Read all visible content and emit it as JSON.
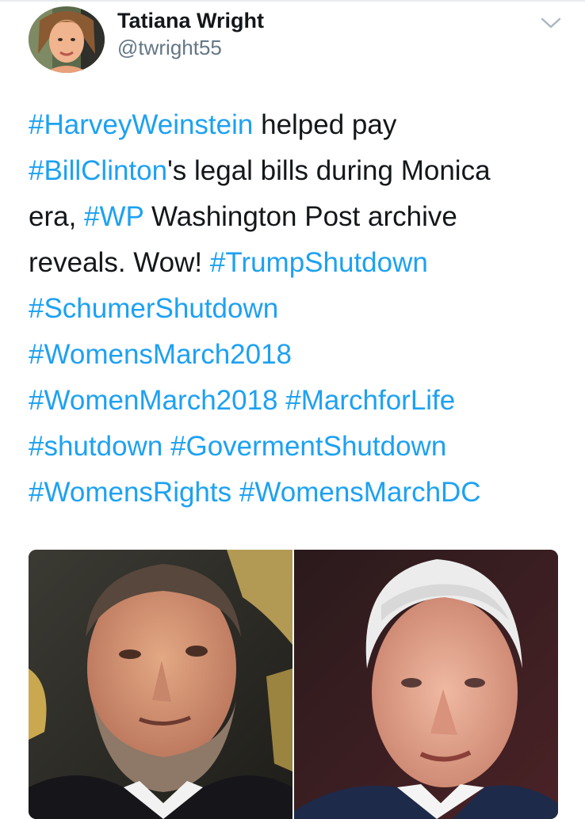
{
  "author": {
    "display_name": "Tatiana Wright",
    "handle": "@twright55",
    "avatar_icon": "profile-photo"
  },
  "menu": {
    "icon": "chevron-down-icon"
  },
  "tweet": {
    "lines": [
      [
        {
          "t": "#HarveyWeinstein",
          "tag": true
        },
        {
          "t": " helped pay",
          "tag": false
        }
      ],
      [
        {
          "t": "#BillClinton",
          "tag": true
        },
        {
          "t": "'s legal bills during Monica",
          "tag": false
        }
      ],
      [
        {
          "t": "era, ",
          "tag": false
        },
        {
          "t": "#WP",
          "tag": true
        },
        {
          "t": " Washington Post archive",
          "tag": false
        }
      ],
      [
        {
          "t": "reveals. Wow! ",
          "tag": false
        },
        {
          "t": "#TrumpShutdown",
          "tag": true
        }
      ],
      [
        {
          "t": "#SchumerShutdown",
          "tag": true
        }
      ],
      [
        {
          "t": "#WomensMarch2018",
          "tag": true
        }
      ],
      [
        {
          "t": "#WomenMarch2018",
          "tag": true
        },
        {
          "t": " ",
          "tag": false
        },
        {
          "t": "#MarchforLife",
          "tag": true
        }
      ],
      [
        {
          "t": "#shutdown",
          "tag": true
        },
        {
          "t": " ",
          "tag": false
        },
        {
          "t": "#GovermentShutdown",
          "tag": true
        }
      ],
      [
        {
          "t": "#WomensRights",
          "tag": true
        },
        {
          "t": " ",
          "tag": false
        },
        {
          "t": "#WomensMarchDC",
          "tag": true
        }
      ]
    ]
  },
  "colors": {
    "link": "#1da1f2",
    "text": "#14171a",
    "secondary": "#657786",
    "divider": "#e6ecf0"
  },
  "media": {
    "photos": [
      "weinstein-photo",
      "clinton-photo"
    ]
  }
}
